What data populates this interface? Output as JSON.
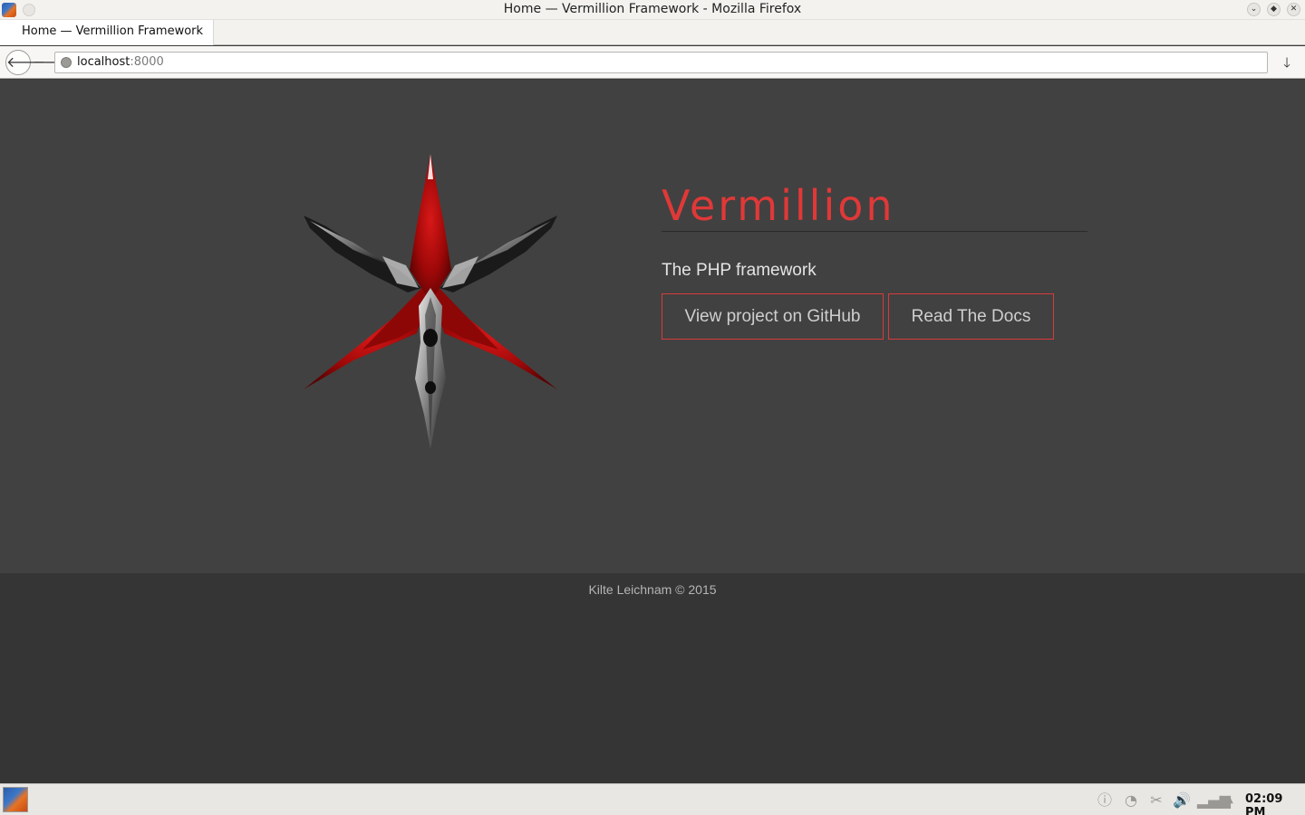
{
  "window": {
    "title": "Home — Vermillion Framework - Mozilla Firefox"
  },
  "tabs": [
    {
      "label": "Home — Vermillion Framework",
      "active": true
    }
  ],
  "navbar": {
    "url_host": "localhost",
    "url_port": ":8000"
  },
  "hero": {
    "title": "Vermillion",
    "subtitle": "The PHP framework",
    "buttons": {
      "github": "View project on GitHub",
      "docs": "Read The Docs"
    }
  },
  "footer": {
    "text": "Kilte Leichnam © 2015"
  },
  "taskbar": {
    "clock": "02:09 PM",
    "tray_icons": [
      "info-icon",
      "gauge-icon",
      "scissors-icon",
      "volume-icon",
      "network-signal-icon",
      "tray-expand-icon"
    ]
  },
  "colors": {
    "accent": "#e03838",
    "page_bg": "#414141",
    "footer_bg": "#353535"
  }
}
